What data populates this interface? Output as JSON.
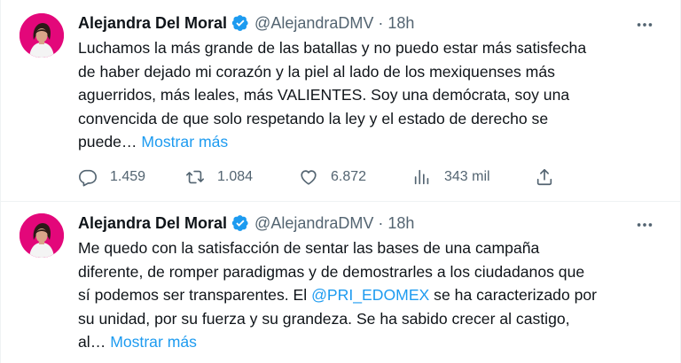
{
  "tweets": [
    {
      "author": {
        "name": "Alejandra Del Moral",
        "handle": "@AlejandraDMV",
        "verified": true,
        "avatar_color": "#e3077a"
      },
      "time": "18h",
      "separator": "·",
      "body_text": "Luchamos la más grande de las batallas y no puedo estar más satisfecha\nde haber dejado mi corazón y la piel al lado de los mexiquenses más\naguerridos, más leales, más VALIENTES.  Soy una demócrata, soy una\nconvencida de que solo respetando la ley y el estado de derecho se\npuede…",
      "show_more": "Mostrar más",
      "metrics": {
        "replies": "1.459",
        "retweets": "1.084",
        "likes": "6.872",
        "views": "343 mil"
      }
    },
    {
      "author": {
        "name": "Alejandra Del Moral",
        "handle": "@AlejandraDMV",
        "verified": true,
        "avatar_color": "#e3077a"
      },
      "time": "18h",
      "separator": "·",
      "body_pre": "Me quedo con la satisfacción de sentar las bases de una campaña\ndiferente, de romper paradigmas y de demostrarles a los ciudadanos que\nsí podemos ser transparentes. El ",
      "mention": "@PRI_EDOMEX",
      "body_post": " se ha caracterizado por\nsu unidad, por su fuerza y su grandeza. Se ha sabido crecer al castigo,\nal…",
      "show_more": "Mostrar más"
    }
  ],
  "colors": {
    "link": "#1d9bf0",
    "secondary_text": "#536471",
    "primary_text": "#0f1419",
    "verified_badge": "#1d9bf0"
  },
  "icons": [
    "verified-badge-icon",
    "more-options-icon",
    "reply-icon",
    "retweet-icon",
    "like-icon",
    "views-icon",
    "share-icon"
  ]
}
